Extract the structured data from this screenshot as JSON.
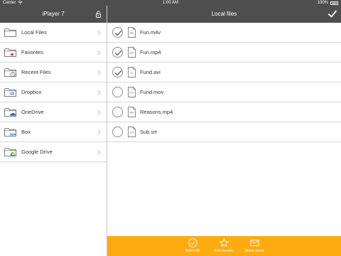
{
  "status_bar": {
    "carrier": "Carrier",
    "time": "1:00 AM",
    "battery": "100%"
  },
  "left_panel": {
    "title": "iPlayer 7",
    "items": [
      {
        "label": "Local Files",
        "icon": "folder-icon"
      },
      {
        "label": "Favorites",
        "icon": "favorites-folder-icon"
      },
      {
        "label": "Recent Files",
        "icon": "recent-folder-icon"
      },
      {
        "label": "Dropbox",
        "icon": "dropbox-folder-icon"
      },
      {
        "label": "OneDrive",
        "icon": "onedrive-folder-icon"
      },
      {
        "label": "Box",
        "icon": "box-folder-icon"
      },
      {
        "label": "Google Drive",
        "icon": "google-drive-folder-icon"
      }
    ]
  },
  "right_panel": {
    "title": "Local files",
    "files": [
      {
        "name": "Fun.m4v",
        "ext": "M4V",
        "selected": true
      },
      {
        "name": "Fun.mp4",
        "ext": "MP4",
        "selected": true
      },
      {
        "name": "Fund.avi",
        "ext": "AVI",
        "selected": true
      },
      {
        "name": "Fund.mov",
        "ext": "MOV",
        "selected": false
      },
      {
        "name": "Reasons.mp4",
        "ext": "MP4",
        "selected": false
      },
      {
        "name": "Sub.srt",
        "ext": "SRT",
        "selected": false
      }
    ]
  },
  "toolbar": {
    "select_all": "Select All",
    "add_favorite": "Add favorite",
    "share_email": "Share email"
  },
  "colors": {
    "header": "#4e4e4e",
    "toolbar": "#fdab10",
    "accent_blue": "#2f7fd8"
  }
}
